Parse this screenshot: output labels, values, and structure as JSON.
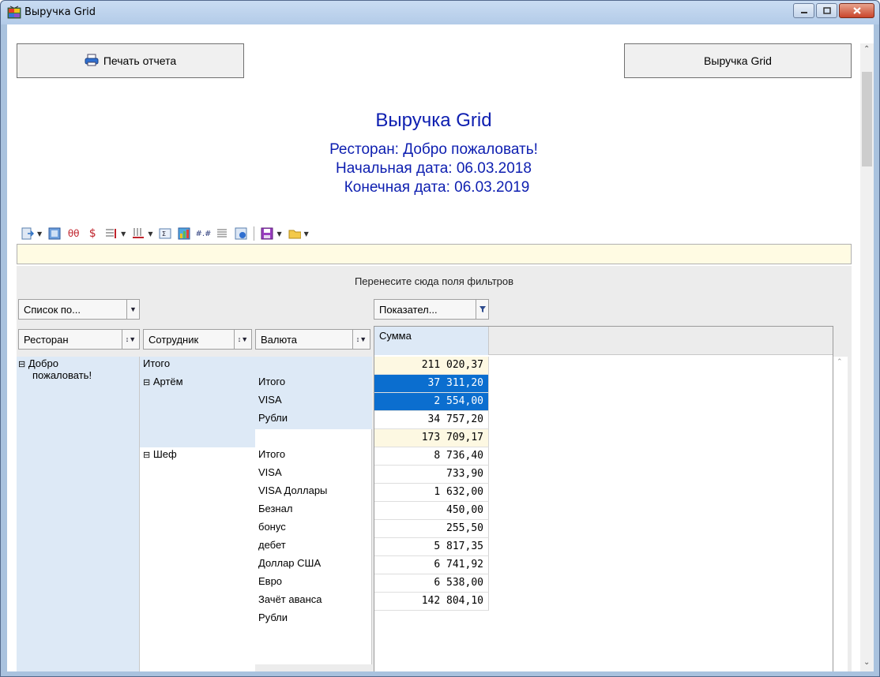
{
  "window": {
    "title": "Выручка Grid"
  },
  "buttons": {
    "print": "Печать отчета",
    "grid": "Выручка Grid"
  },
  "report": {
    "title": "Выручка Grid",
    "restaurant_line": "Ресторан: Добро пожаловать!",
    "start_line": "Начальная дата: 06.03.2018",
    "end_line": "Конечная дата: 06.03.2019"
  },
  "pivot": {
    "filter_hint": "Перенесите сюда поля фильтров",
    "list_field": "Список по...",
    "data_field": "Показател...",
    "row_fields": [
      "Ресторан",
      "Сотрудник",
      "Валюта"
    ],
    "column_header": "Сумма",
    "restaurant": "Добро пожаловать!",
    "restaurant_lines": [
      "Добро",
      "пожаловать!"
    ],
    "restaurant_total_label": "Итого",
    "employees": [
      {
        "name": "Артём",
        "rows": [
          "Итого",
          "VISA",
          "Рубли"
        ]
      },
      {
        "name": "Шеф",
        "rows": [
          "Итого",
          "VISA",
          "VISA Доллары",
          "Безнал",
          "бонус",
          "дебет",
          "Доллар США",
          "Евро",
          "Зачёт аванса",
          "Рубли"
        ]
      }
    ],
    "values": [
      "211 020,37",
      "37 311,20",
      "2 554,00",
      "34 757,20",
      "173 709,17",
      "8 736,40",
      "733,90",
      "1 632,00",
      "450,00",
      "255,50",
      "5 817,35",
      "6 741,92",
      "6 538,00",
      "142 804,10"
    ],
    "selected_rows": [
      1,
      2
    ]
  }
}
